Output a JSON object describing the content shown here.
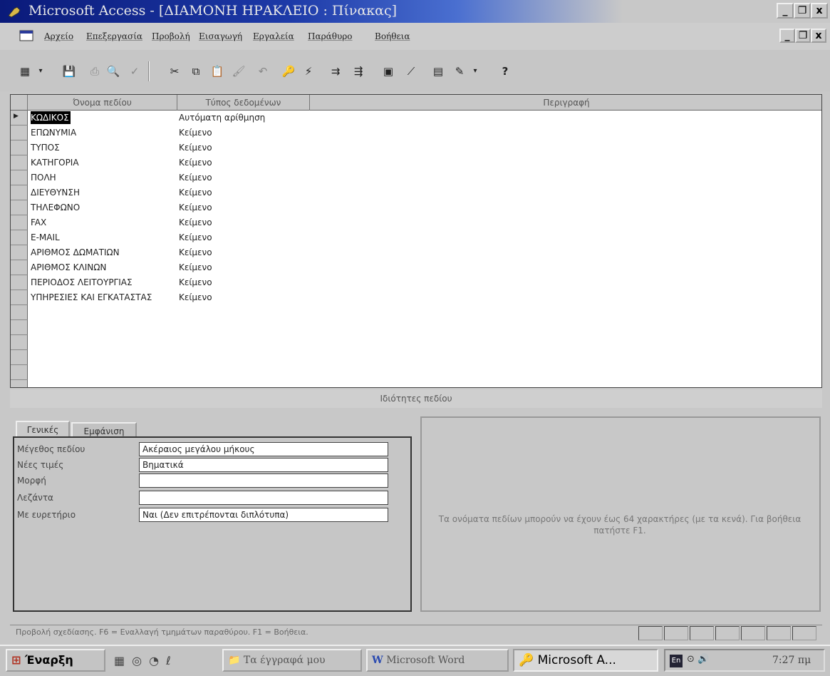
{
  "window": {
    "title": "Microsoft Access - [ΔΙΑΜΟΝΗ ΗΡΑΚΛΕΙΟ : Πίνακας]"
  },
  "window_controls": {
    "minimize": "_",
    "maximize": "❐",
    "close": "x"
  },
  "menu": {
    "items": [
      "Αρχείο",
      "Επεξεργασία",
      "Προβολή",
      "Εισαγωγή",
      "Εργαλεία",
      "Παράθυρο",
      "Βοήθεια"
    ]
  },
  "grid": {
    "columns": [
      "Όνομα πεδίου",
      "Τύπος δεδομένων",
      "Περιγραφή"
    ],
    "rows": [
      {
        "name": "ΚΩΔΙΚΟΣ",
        "type": "Αυτόματη αρίθμηση"
      },
      {
        "name": "ΕΠΩΝΥΜΙΑ",
        "type": "Κείμενο"
      },
      {
        "name": "ΤΥΠΟΣ",
        "type": "Κείμενο"
      },
      {
        "name": "ΚΑΤΗΓΟΡΙΑ",
        "type": "Κείμενο"
      },
      {
        "name": "ΠΟΛΗ",
        "type": "Κείμενο"
      },
      {
        "name": "ΔΙΕΥΘΥΝΣΗ",
        "type": "Κείμενο"
      },
      {
        "name": "ΤΗΛΕΦΩΝΟ",
        "type": "Κείμενο"
      },
      {
        "name": "FAX",
        "type": "Κείμενο"
      },
      {
        "name": "E-MAIL",
        "type": "Κείμενο"
      },
      {
        "name": "ΑΡΙΘΜΟΣ ΔΩΜΑΤΙΩΝ",
        "type": "Κείμενο"
      },
      {
        "name": "ΑΡΙΘΜΟΣ ΚΛΙΝΩΝ",
        "type": "Κείμενο"
      },
      {
        "name": "ΠΕΡΙΟΔΟΣ ΛΕΙΤΟΥΡΓΙΑΣ",
        "type": "Κείμενο"
      },
      {
        "name": "ΥΠΗΡΕΣΙΕΣ ΚΑΙ ΕΓΚΑΤΑΣΤΑΣ",
        "type": "Κείμενο"
      }
    ]
  },
  "properties": {
    "title": "Ιδιότητες πεδίου",
    "tabs": [
      "Γενικές",
      "Εμφάνιση"
    ],
    "fields": [
      {
        "label": "Μέγεθος πεδίου",
        "value": "Ακέραιος μεγάλου μήκους"
      },
      {
        "label": "Νέες τιμές",
        "value": "Βηματικά"
      },
      {
        "label": "Μορφή",
        "value": ""
      },
      {
        "label": "Λεζάντα",
        "value": ""
      },
      {
        "label": "Με ευρετήριο",
        "value": "Ναι (Δεν επιτρέπονται διπλότυπα)"
      }
    ],
    "help": "Τα ονόματα πεδίων μπορούν να έχουν έως 64 χαρακτήρες (με τα κενά). Για βοήθεια πατήστε F1."
  },
  "statusbar": {
    "text": "Προβολή σχεδίασης. F6 = Εναλλαγή τμημάτων παραθύρου. F1 = Βοήθεια."
  },
  "taskbar": {
    "start": "Έναρξη",
    "buttons": [
      "Τα έγγραφά μου",
      "Microsoft Word",
      "Microsoft A..."
    ],
    "lang": "En",
    "clock": "7:27 πμ"
  }
}
